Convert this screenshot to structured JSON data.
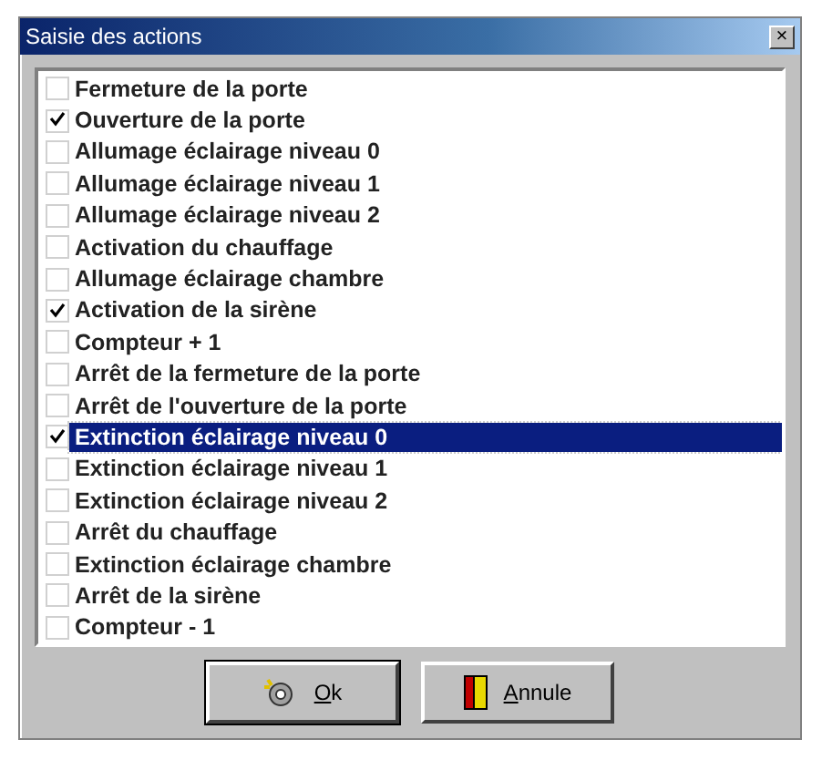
{
  "window": {
    "title": "Saisie des actions",
    "close": "×"
  },
  "actions": [
    {
      "label": "Fermeture de la porte",
      "checked": false,
      "selected": false
    },
    {
      "label": "Ouverture de la porte",
      "checked": true,
      "selected": false
    },
    {
      "label": "Allumage éclairage niveau 0",
      "checked": false,
      "selected": false
    },
    {
      "label": "Allumage éclairage niveau 1",
      "checked": false,
      "selected": false
    },
    {
      "label": "Allumage éclairage niveau 2",
      "checked": false,
      "selected": false
    },
    {
      "label": "Activation du chauffage",
      "checked": false,
      "selected": false
    },
    {
      "label": "Allumage éclairage chambre",
      "checked": false,
      "selected": false
    },
    {
      "label": "Activation de la sirène",
      "checked": true,
      "selected": false
    },
    {
      "label": "Compteur + 1",
      "checked": false,
      "selected": false
    },
    {
      "label": "Arrêt de la fermeture de la porte",
      "checked": false,
      "selected": false
    },
    {
      "label": "Arrêt de l'ouverture de la porte",
      "checked": false,
      "selected": false
    },
    {
      "label": "Extinction éclairage niveau 0",
      "checked": true,
      "selected": true
    },
    {
      "label": "Extinction éclairage niveau 1",
      "checked": false,
      "selected": false
    },
    {
      "label": "Extinction éclairage niveau 2",
      "checked": false,
      "selected": false
    },
    {
      "label": "Arrêt du chauffage",
      "checked": false,
      "selected": false
    },
    {
      "label": "Extinction éclairage chambre",
      "checked": false,
      "selected": false
    },
    {
      "label": "Arrêt de la sirène",
      "checked": false,
      "selected": false
    },
    {
      "label": "Compteur - 1",
      "checked": false,
      "selected": false
    }
  ],
  "buttons": [
    {
      "kind": "ok",
      "label": "Ok",
      "mnemonic": true
    },
    {
      "kind": "cancel",
      "label": "Annule",
      "mnemonic": true
    }
  ]
}
